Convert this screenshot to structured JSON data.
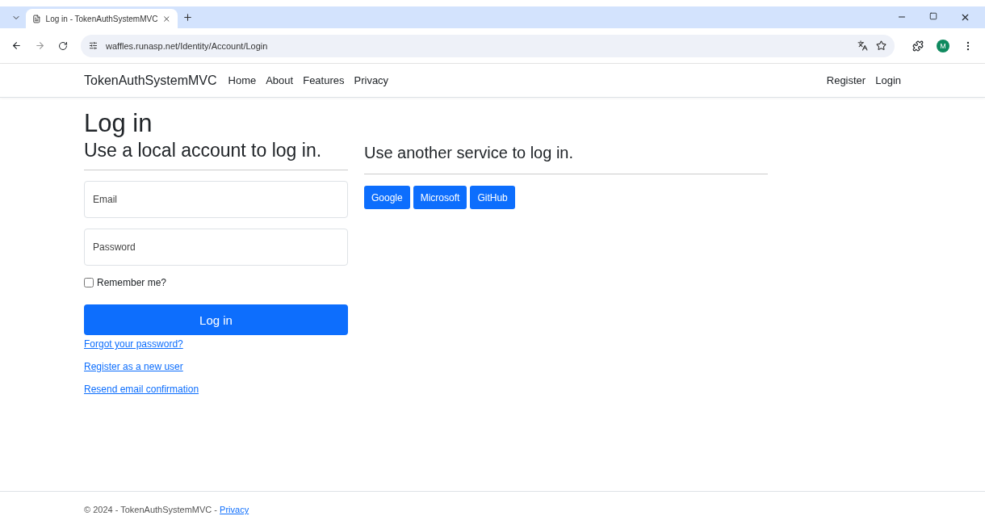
{
  "browser": {
    "tab_title": "Log in - TokenAuthSystemMVC",
    "url": "waffles.runasp.net/Identity/Account/Login",
    "profile_initial": "M"
  },
  "navbar": {
    "brand": "TokenAuthSystemMVC",
    "links": [
      "Home",
      "About",
      "Features",
      "Privacy"
    ],
    "right_links": [
      "Register",
      "Login"
    ]
  },
  "page": {
    "title": "Log in",
    "local_heading": "Use a local account to log in.",
    "external_heading": "Use another service to log in.",
    "fields": [
      {
        "placeholder": "Email"
      },
      {
        "placeholder": "Password"
      }
    ],
    "remember": {
      "label": "Remember me?",
      "checked": false
    },
    "submit": "Log in",
    "links": [
      "Forgot your password?",
      "Register as a new user",
      "Resend email confirmation"
    ],
    "providers": [
      "Google",
      "Microsoft",
      "GitHub"
    ]
  },
  "footer": {
    "text": "© 2024 - TokenAuthSystemMVC - ",
    "link": "Privacy"
  }
}
